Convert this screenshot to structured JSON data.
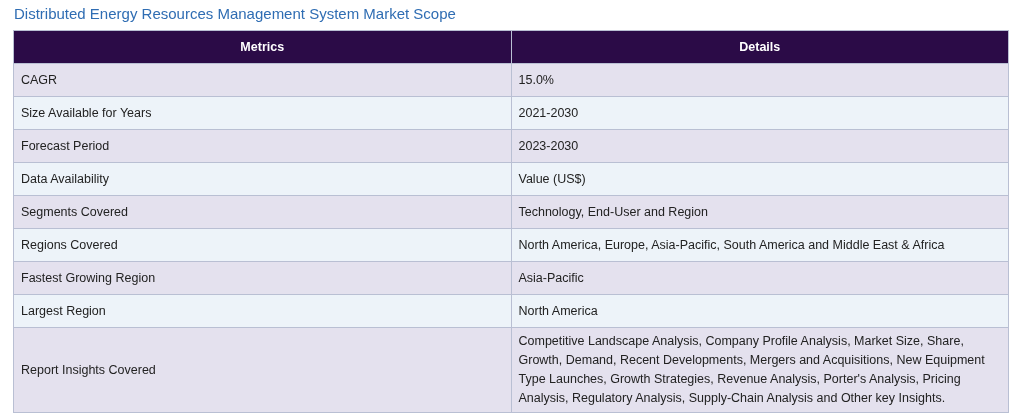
{
  "title": "Distributed Energy Resources Management System Market Scope",
  "table": {
    "columns": [
      "Metrics",
      "Details"
    ],
    "rows": [
      {
        "metric": "CAGR",
        "details": "15.0%"
      },
      {
        "metric": "Size Available for Years",
        "details": "2021-2030"
      },
      {
        "metric": "Forecast Period",
        "details": "2023-2030"
      },
      {
        "metric": "Data Availability",
        "details": "Value (US$)"
      },
      {
        "metric": "Segments Covered",
        "details": "Technology, End-User and Region"
      },
      {
        "metric": "Regions Covered",
        "details": "North America, Europe, Asia-Pacific, South America and Middle East & Africa"
      },
      {
        "metric": "Fastest Growing Region",
        "details": "Asia-Pacific"
      },
      {
        "metric": "Largest Region",
        "details": "North America"
      },
      {
        "metric": "Report Insights Covered",
        "details": "Competitive Landscape Analysis, Company Profile Analysis, Market Size, Share, Growth, Demand, Recent Developments, Mergers and Acquisitions, New Equipment Type Launches, Growth Strategies, Revenue Analysis, Porter's Analysis, Pricing Analysis, Regulatory Analysis, Supply-Chain Analysis and Other key Insights."
      }
    ]
  }
}
